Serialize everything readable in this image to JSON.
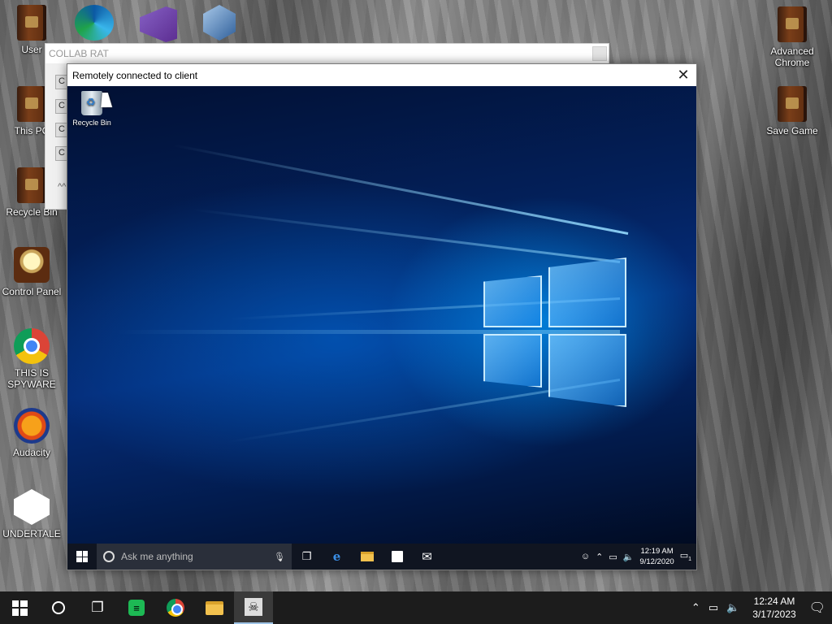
{
  "desktop": {
    "left_icons": [
      {
        "label": "User",
        "icon": "book-icon"
      },
      {
        "label": "This PC",
        "icon": "book-icon"
      },
      {
        "label": "Recycle Bin",
        "icon": "book-icon"
      },
      {
        "label": "Control Panel",
        "icon": "lightbulb-icon"
      },
      {
        "label": "THIS IS SPYWARE",
        "icon": "chrome-icon"
      },
      {
        "label": "Audacity",
        "icon": "audacity-icon"
      },
      {
        "label": "UNDERTALE",
        "icon": "unity-icon"
      }
    ],
    "right_icons": [
      {
        "label": "Advanced Chrome",
        "icon": "book-icon"
      },
      {
        "label": "Save Game",
        "icon": "book-icon"
      }
    ]
  },
  "collab_window": {
    "title": "COLLAB RAT",
    "buttons": [
      "C",
      "C",
      "C",
      "C"
    ],
    "tilde": "^^"
  },
  "remote_window": {
    "title": "Remotely connected to client",
    "close_glyph": "✕",
    "desktop_icon": {
      "label": "Recycle Bin"
    },
    "taskbar": {
      "search_placeholder": "Ask me anything",
      "time": "12:19 AM",
      "date": "9/12/2020",
      "notification_count": "1"
    }
  },
  "taskbar": {
    "time": "12:24 AM",
    "date": "3/17/2023"
  },
  "colors": {
    "taskbar_bg": "#1c1c1c",
    "remote_taskbar_bg": "#101521",
    "wallpaper_blue": "#052c78"
  }
}
